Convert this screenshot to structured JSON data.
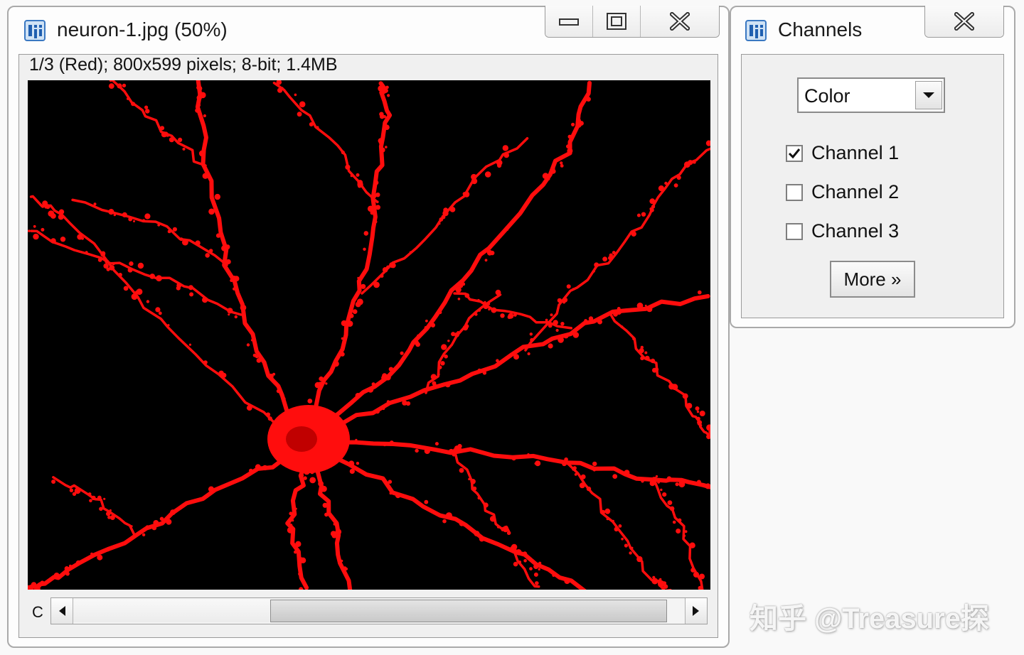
{
  "image_window": {
    "title": "neuron-1.jpg (50%)",
    "status": "1/3 (Red); 800x599 pixels; 8-bit; 1.4MB",
    "slider_label": "C",
    "image_subject": "red fluorescent neuron with branching dendrites on black background",
    "channel_color": "#ff0d0d"
  },
  "channels_window": {
    "title": "Channels",
    "mode": "Color",
    "channels": [
      {
        "label": "Channel 1",
        "checked": true
      },
      {
        "label": "Channel 2",
        "checked": false
      },
      {
        "label": "Channel 3",
        "checked": false
      }
    ],
    "more_label": "More »"
  },
  "window_controls": {
    "minimize": "minimize-icon",
    "maximize": "maximize-icon",
    "close": "close-icon"
  },
  "watermark": "知乎 @Treasure探"
}
